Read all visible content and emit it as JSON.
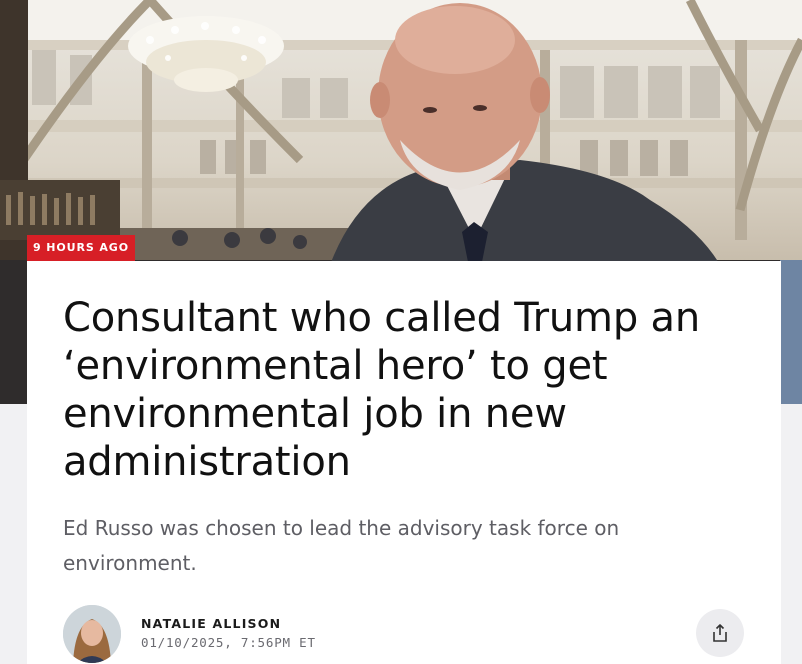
{
  "article": {
    "time_badge": "9 HOURS AGO",
    "headline": "Consultant who called Trump an ‘environmental hero’ to get environmental job in new administration",
    "dek": "Ed Russo was chosen to lead the advisory task force on environment.",
    "author": {
      "name": "NATALIE ALLISON",
      "timestamp": "01/10/2025, 7:56PM ET"
    }
  },
  "icons": {
    "share": "share-icon"
  },
  "colors": {
    "badge": "#d71f26",
    "card": "#ffffff",
    "page_background": "#f1f1f3",
    "headline": "#111111",
    "dek": "#5e5e64"
  }
}
